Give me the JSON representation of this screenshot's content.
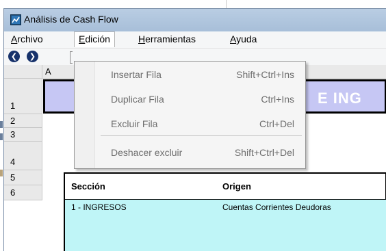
{
  "window": {
    "title": "Análisis de Cash Flow"
  },
  "menubar": {
    "items": [
      {
        "label": "Archivo",
        "mnemonic": "A",
        "rest": "rchivo"
      },
      {
        "label": "Edición",
        "mnemonic": "E",
        "rest": "dición"
      },
      {
        "label": "Herramientas",
        "mnemonic": "H",
        "rest": "erramientas"
      },
      {
        "label": "Ayuda",
        "mnemonic": "A",
        "rest": "yuda"
      }
    ],
    "open_menu": "Edición"
  },
  "toolbar": {
    "buttons": [
      "back-icon",
      "forward-icon"
    ]
  },
  "dropdown": {
    "items": [
      {
        "label": "Insertar Fila",
        "shortcut": "Shift+Ctrl+Ins",
        "enabled": false
      },
      {
        "label": "Duplicar Fila",
        "shortcut": "Ctrl+Ins",
        "enabled": false
      },
      {
        "label": "Excluir Fila",
        "shortcut": "Ctrl+Del",
        "enabled": false
      },
      {
        "label": "Deshacer excluir",
        "shortcut": "Shift+Ctrl+Del",
        "enabled": false
      }
    ]
  },
  "grid": {
    "columns": [
      "A"
    ],
    "rows": [
      "1",
      "2",
      "3",
      "4",
      "5",
      "6"
    ],
    "banner_text": "E ING",
    "table": {
      "headers": [
        "Sección",
        "Origen"
      ],
      "rows": [
        [
          "1 - INGRESOS",
          "Cuentas Corrientes Deudoras"
        ]
      ]
    }
  },
  "colors": {
    "banner_bg": "#c6c7f4",
    "table_body_bg": "#bff5f7",
    "nav_button": "#17326b",
    "title_bar": "#a9c1dc"
  }
}
